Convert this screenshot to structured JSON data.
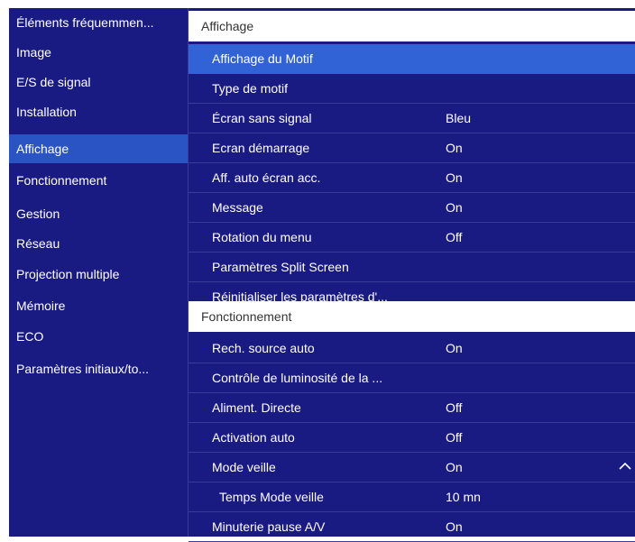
{
  "sidebar": {
    "items": [
      {
        "label": "Éléments fréquemmen...",
        "selected": false
      },
      {
        "label": "Image",
        "selected": false
      },
      {
        "label": "E/S de signal",
        "selected": false
      },
      {
        "label": "Installation",
        "selected": false
      },
      {
        "label": "Affichage",
        "selected": true
      },
      {
        "label": "Fonctionnement",
        "selected": false
      },
      {
        "label": "Gestion",
        "selected": false
      },
      {
        "label": "Réseau",
        "selected": false
      },
      {
        "label": "Projection multiple",
        "selected": false
      },
      {
        "label": "Mémoire",
        "selected": false
      },
      {
        "label": "ECO",
        "selected": false
      },
      {
        "label": "Paramètres initiaux/to...",
        "selected": false
      }
    ]
  },
  "main": {
    "sections": [
      {
        "title": "Affichage",
        "rows": [
          {
            "label": "Affichage du Motif",
            "value": "",
            "selected": true
          },
          {
            "label": "Type de motif",
            "value": ""
          },
          {
            "label": "Écran sans signal",
            "value": "Bleu"
          },
          {
            "label": "Ecran démarrage",
            "value": "On"
          },
          {
            "label": "Aff. auto écran acc.",
            "value": "On"
          },
          {
            "label": "Message",
            "value": "On"
          },
          {
            "label": "Rotation du menu",
            "value": "Off"
          },
          {
            "label": "Paramètres Split Screen",
            "value": ""
          },
          {
            "label": "Réinitialiser les paramètres d'...",
            "value": ""
          }
        ]
      },
      {
        "title": "Fonctionnement",
        "rows": [
          {
            "label": "Rech. source auto",
            "value": "On"
          },
          {
            "label": "Contrôle de luminosité de la ...",
            "value": ""
          },
          {
            "label": "Aliment. Directe",
            "value": "Off"
          },
          {
            "label": "Activation auto",
            "value": "Off"
          },
          {
            "label": "Mode veille",
            "value": "On",
            "icon": "chevron-up-icon"
          },
          {
            "label": "Temps Mode veille",
            "value": "10 mn",
            "indent": true
          },
          {
            "label": "Minuterie pause A/V",
            "value": "On"
          }
        ]
      }
    ]
  },
  "colors": {
    "panel_bg": "#1a1b82",
    "selected_sidebar": "#2a53c4",
    "selected_row": "#3163d6",
    "section_header_bg": "#ffffff",
    "text": "#ffffff"
  }
}
